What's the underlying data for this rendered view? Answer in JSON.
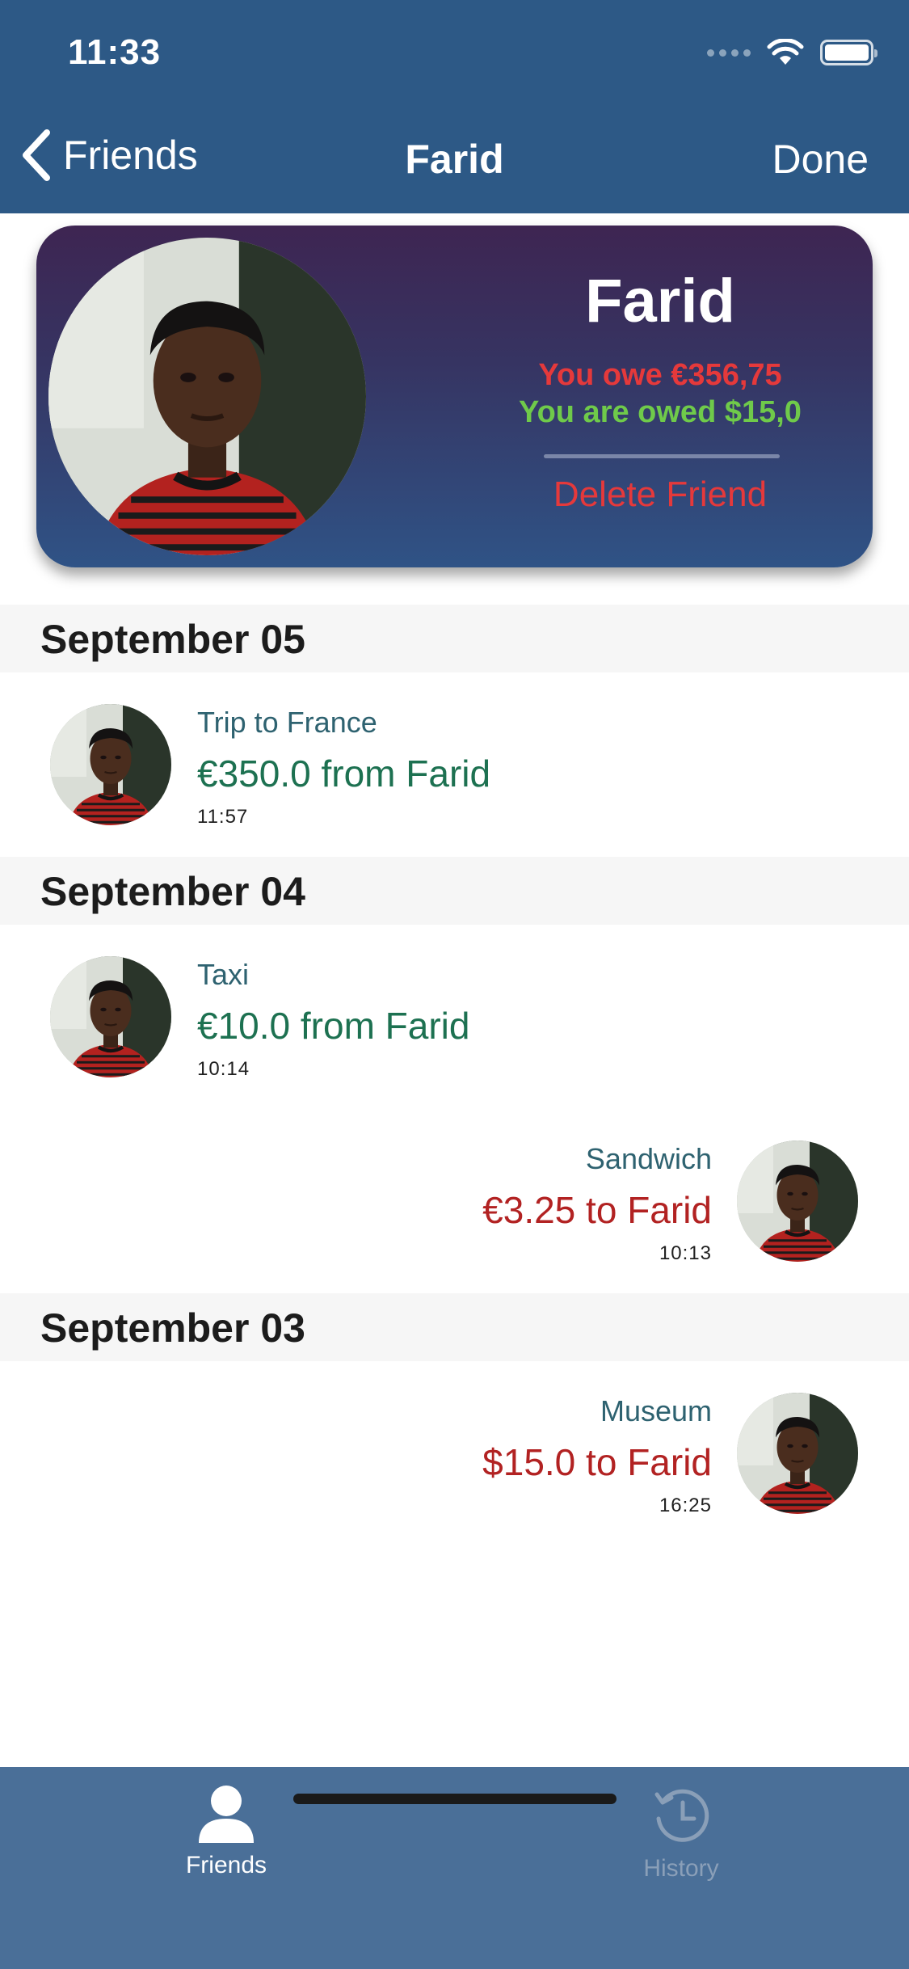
{
  "status_bar": {
    "time": "11:33"
  },
  "nav": {
    "back_label": "Friends",
    "title": "Farid",
    "done_label": "Done"
  },
  "profile": {
    "name": "Farid",
    "you_owe": "You owe €356,75",
    "you_are_owed": "You are owed $15,0",
    "delete_label": "Delete Friend"
  },
  "sections": [
    {
      "date": "September 05",
      "items": [
        {
          "label": "Trip to France",
          "amount": "€350.0 from Farid",
          "time": "11:57",
          "direction": "from"
        }
      ]
    },
    {
      "date": "September 04",
      "items": [
        {
          "label": "Taxi",
          "amount": "€10.0 from Farid",
          "time": "10:14",
          "direction": "from"
        },
        {
          "label": "Sandwich",
          "amount": "€3.25 to Farid",
          "time": "10:13",
          "direction": "to"
        }
      ]
    },
    {
      "date": "September 03",
      "items": [
        {
          "label": "Museum",
          "amount": "$15.0 to Farid",
          "time": "16:25",
          "direction": "to"
        }
      ]
    }
  ],
  "tabs": [
    {
      "label": "Friends",
      "icon": "person-icon",
      "active": true
    },
    {
      "label": "History",
      "icon": "clock-history-icon",
      "active": false
    }
  ],
  "colors": {
    "nav_bar": "#2d5986",
    "tab_bar": "#4a6f98",
    "owe": "#e5393b",
    "owed": "#6fca4a",
    "from_amount": "#1d7151",
    "to_amount": "#b22222"
  }
}
